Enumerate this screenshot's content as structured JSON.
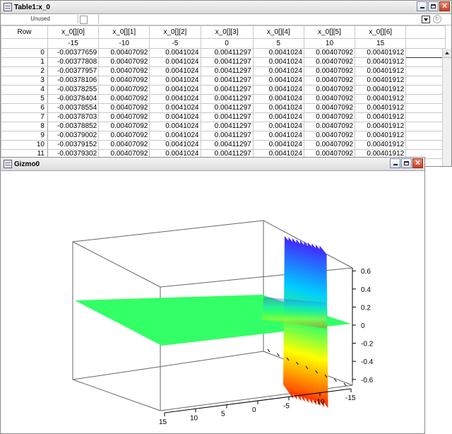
{
  "table_window": {
    "title": "Table1:x_0",
    "unused_label": "Unused",
    "header": {
      "row_label": "Row",
      "columns": [
        "x_0[][0]",
        "x_0[][1]",
        "x_0[][2]",
        "x_0[][3]",
        "x_0[][4]",
        "x_0[][5]",
        "x_0[][6]"
      ],
      "params": [
        "-15",
        "-10",
        "-5",
        "0",
        "5",
        "10",
        "15"
      ]
    },
    "rows": [
      {
        "n": "0",
        "v": [
          "-0.00377659",
          "0.00407092",
          "0.0041024",
          "0.00411297",
          "0.0041024",
          "0.00407092",
          "0.00401912"
        ]
      },
      {
        "n": "1",
        "v": [
          "-0.00377808",
          "0.00407092",
          "0.0041024",
          "0.00411297",
          "0.0041024",
          "0.00407092",
          "0.00401912"
        ]
      },
      {
        "n": "2",
        "v": [
          "-0.00377957",
          "0.00407092",
          "0.0041024",
          "0.00411297",
          "0.0041024",
          "0.00407092",
          "0.00401912"
        ]
      },
      {
        "n": "3",
        "v": [
          "-0.00378106",
          "0.00407092",
          "0.0041024",
          "0.00411297",
          "0.0041024",
          "0.00407092",
          "0.00401912"
        ]
      },
      {
        "n": "4",
        "v": [
          "-0.00378255",
          "0.00407092",
          "0.0041024",
          "0.00411297",
          "0.0041024",
          "0.00407092",
          "0.00401912"
        ]
      },
      {
        "n": "5",
        "v": [
          "-0.00378404",
          "0.00407092",
          "0.0041024",
          "0.00411297",
          "0.0041024",
          "0.00407092",
          "0.00401912"
        ]
      },
      {
        "n": "6",
        "v": [
          "-0.00378554",
          "0.00407092",
          "0.0041024",
          "0.00411297",
          "0.0041024",
          "0.00407092",
          "0.00401912"
        ]
      },
      {
        "n": "7",
        "v": [
          "-0.00378703",
          "0.00407092",
          "0.0041024",
          "0.00411297",
          "0.0041024",
          "0.00407092",
          "0.00401912"
        ]
      },
      {
        "n": "8",
        "v": [
          "-0.00378852",
          "0.00407092",
          "0.0041024",
          "0.00411297",
          "0.0041024",
          "0.00407092",
          "0.00401912"
        ]
      },
      {
        "n": "9",
        "v": [
          "-0.00379002",
          "0.00407092",
          "0.0041024",
          "0.00411297",
          "0.0041024",
          "0.00407092",
          "0.00401912"
        ]
      },
      {
        "n": "10",
        "v": [
          "-0.00379152",
          "0.00407092",
          "0.0041024",
          "0.00411297",
          "0.0041024",
          "0.00407092",
          "0.00401912"
        ]
      },
      {
        "n": "11",
        "v": [
          "-0.00379302",
          "0.00407092",
          "0.0041024",
          "0.00411297",
          "0.0041024",
          "0.00407092",
          "0.00401912"
        ]
      }
    ],
    "icons": {
      "window": "table-icon",
      "dropdown": "dropdown-icon",
      "sync": "sync-icon"
    }
  },
  "gizmo_window": {
    "title": "Gizmo0",
    "icons": {
      "window": "gizmo-icon"
    }
  },
  "window_controls": {
    "minimize": "minimize-icon",
    "maximize": "maximize-icon",
    "close": "close-icon"
  },
  "chart_data": {
    "type": "surface",
    "title": "",
    "x_ticks": [
      "15",
      "10",
      "5",
      "0",
      "-5",
      "-10",
      "-15"
    ],
    "z_ticks": [
      "0.6",
      "0.4",
      "0.2",
      "0",
      "-0.2",
      "-0.4",
      "-0.6"
    ],
    "z_values": [
      0.6,
      0.4,
      0.2,
      0,
      -0.2,
      -0.4,
      -0.6
    ],
    "colors": {
      "flat_surface": "#33ff66",
      "peak_high": "#4422ff",
      "peak_low": "#ff2200"
    },
    "grid": false
  }
}
